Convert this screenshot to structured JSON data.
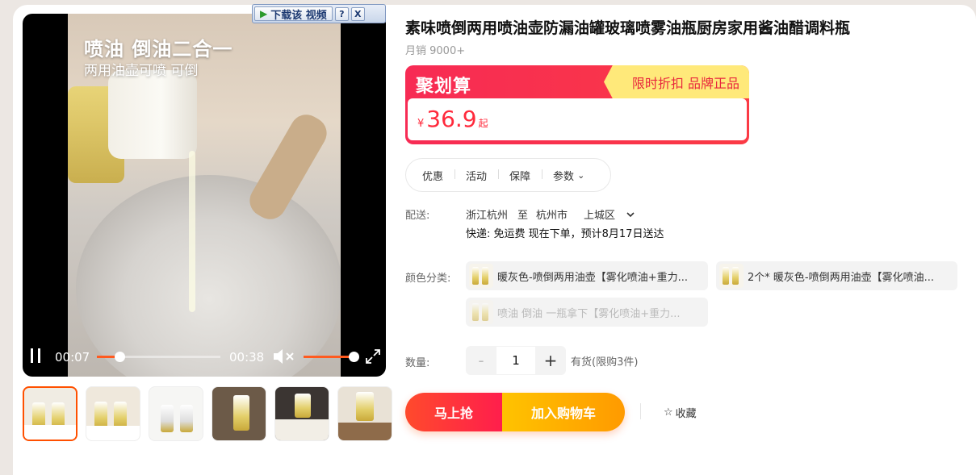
{
  "video": {
    "overlay_title": "喷油 倒油二合一",
    "overlay_subtitle": "两用油壶可喷 可倒",
    "current_time": "00:07",
    "duration": "00:38",
    "progress": 0.18,
    "volume": 1.0
  },
  "download_bar": {
    "label": "下载该 视频",
    "help": "?",
    "close": "X"
  },
  "thumbnails": [
    {
      "label": "thumb-1"
    },
    {
      "label": "thumb-2"
    },
    {
      "label": "thumb-3"
    },
    {
      "label": "thumb-4"
    },
    {
      "label": "thumb-5"
    },
    {
      "label": "thumb-6"
    }
  ],
  "product": {
    "title": "素味喷倒两用喷油壶防漏油罐玻璃喷雾油瓶厨房家用酱油醋调料瓶",
    "sales": "月销 9000+"
  },
  "promo": {
    "brand": "聚划算",
    "tag": "限时折扣 品牌正品",
    "currency": "¥",
    "price": "36.9",
    "suffix": "起",
    "colors": {
      "primary": "#f72b54",
      "tag_bg": "#ffe97a"
    }
  },
  "tabs": [
    {
      "label": "优惠"
    },
    {
      "label": "活动"
    },
    {
      "label": "保障"
    },
    {
      "label": "参数"
    }
  ],
  "shipping": {
    "label": "配送:",
    "from": "浙江杭州",
    "to_word": "至",
    "city": "杭州市",
    "district": "上城区",
    "delivery": "快递: 免运费  现在下单，预计8月17日送达"
  },
  "sku": {
    "label": "颜色分类:",
    "options": [
      {
        "text": "暖灰色-喷倒两用油壶【雾化喷油+重力...",
        "disabled": false
      },
      {
        "text": "2个* 暖灰色-喷倒两用油壶【雾化喷油...",
        "disabled": false
      },
      {
        "text": "喷油 倒油 一瓶拿下【雾化喷油+重力...",
        "disabled": true
      }
    ]
  },
  "quantity": {
    "label": "数量:",
    "minus": "-",
    "value": "1",
    "plus": "+",
    "stock": "有货(限购3件)"
  },
  "actions": {
    "buy_now": "马上抢",
    "add_to_cart": "加入购物车",
    "favorite_icon": "☆",
    "favorite": "收藏"
  }
}
